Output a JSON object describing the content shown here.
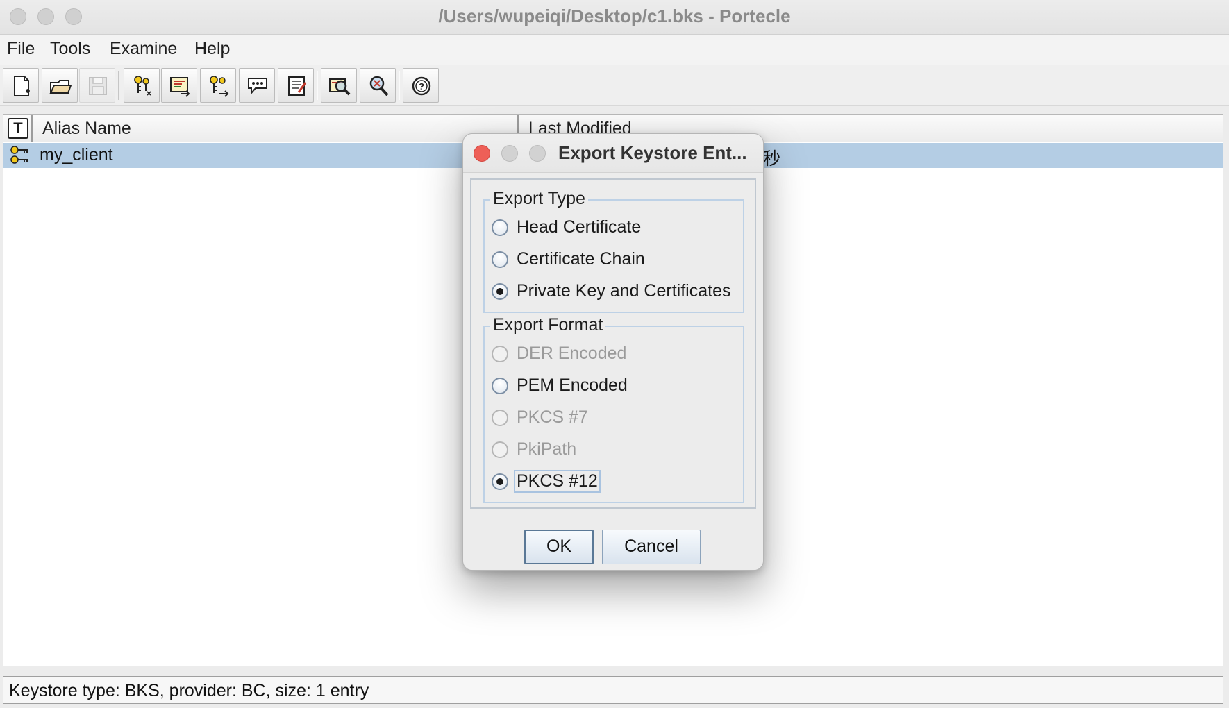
{
  "window": {
    "title": "/Users/wupeiqi/Desktop/c1.bks - Portecle"
  },
  "menu": [
    {
      "label": "File"
    },
    {
      "label": "Tools"
    },
    {
      "label": "Examine"
    },
    {
      "label": "Help"
    }
  ],
  "toolbar": {
    "icons": [
      "new-keystore-icon",
      "open-keystore-icon",
      "save-keystore-icon",
      "generate-keypair-icon",
      "import-certificate-icon",
      "import-keypair-icon",
      "set-password-icon",
      "keystore-properties-icon",
      "examine-certificate-icon",
      "examine-crl-icon",
      "help-icon"
    ]
  },
  "table": {
    "header_icon": "T",
    "columns": [
      "Alias Name",
      "Last Modified"
    ],
    "rows": [
      {
        "alias": "my_client",
        "last_modified_visible": "秒"
      }
    ]
  },
  "status": {
    "text": "Keystore type: BKS, provider: BC, size: 1 entry"
  },
  "dialog": {
    "title": "Export Keystore Ent...",
    "export_type": {
      "title": "Export Type",
      "options": [
        {
          "label": "Head Certificate",
          "selected": false,
          "disabled": false
        },
        {
          "label": "Certificate Chain",
          "selected": false,
          "disabled": false
        },
        {
          "label": "Private Key and Certificates",
          "selected": true,
          "disabled": false
        }
      ]
    },
    "export_format": {
      "title": "Export Format",
      "options": [
        {
          "label": "DER Encoded",
          "selected": false,
          "disabled": true
        },
        {
          "label": "PEM Encoded",
          "selected": false,
          "disabled": false
        },
        {
          "label": "PKCS #7",
          "selected": false,
          "disabled": true
        },
        {
          "label": "PkiPath",
          "selected": false,
          "disabled": true
        },
        {
          "label": "PKCS #12",
          "selected": true,
          "disabled": false
        }
      ]
    },
    "ok_label": "OK",
    "cancel_label": "Cancel"
  },
  "colors": {
    "selection": "#b4cde4",
    "close": "#ee5f57"
  }
}
